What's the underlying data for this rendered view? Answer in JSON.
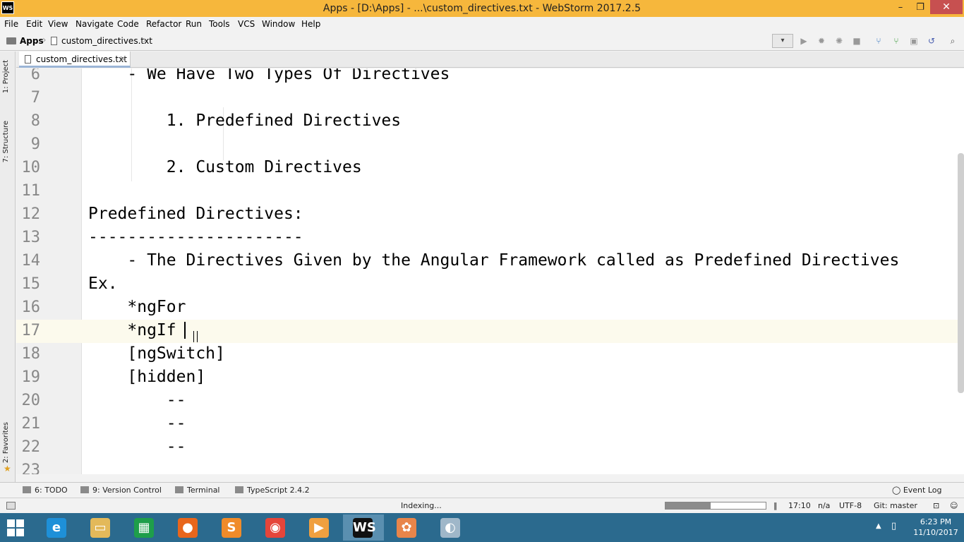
{
  "window": {
    "title": "Apps - [D:\\Apps] - ...\\custom_directives.txt - WebStorm 2017.2.5",
    "app_icon": "WS",
    "minimize": "–",
    "maximize": "❐",
    "close": "✕"
  },
  "menu": [
    "File",
    "Edit",
    "View",
    "Navigate",
    "Code",
    "Refactor",
    "Run",
    "Tools",
    "VCS",
    "Window",
    "Help"
  ],
  "breadcrumb": {
    "project": "Apps",
    "file": "custom_directives.txt"
  },
  "editor_tab": {
    "label": "custom_directives.txt",
    "close": "×"
  },
  "left_tools": {
    "project": "1: Project",
    "structure": "7: Structure",
    "favorites": "2: Favorites"
  },
  "code_lines": [
    {
      "n": "6",
      "text": "    - We Have Two Types Of Directives"
    },
    {
      "n": "7",
      "text": ""
    },
    {
      "n": "8",
      "text": "        1. Predefined Directives"
    },
    {
      "n": "9",
      "text": ""
    },
    {
      "n": "10",
      "text": "        2. Custom Directives"
    },
    {
      "n": "11",
      "text": ""
    },
    {
      "n": "12",
      "text": "Predefined Directives:"
    },
    {
      "n": "13",
      "text": "----------------------"
    },
    {
      "n": "14",
      "text": "    - The Directives Given by the Angular Framework called as Predefined Directives"
    },
    {
      "n": "15",
      "text": "Ex."
    },
    {
      "n": "16",
      "text": "    *ngFor"
    },
    {
      "n": "17",
      "text": "    *ngIf"
    },
    {
      "n": "18",
      "text": "    [ngSwitch]"
    },
    {
      "n": "19",
      "text": "    [hidden]"
    },
    {
      "n": "20",
      "text": "        --"
    },
    {
      "n": "21",
      "text": "        --"
    },
    {
      "n": "22",
      "text": "        --"
    },
    {
      "n": "23",
      "text": ""
    }
  ],
  "tool_windows": {
    "todo": "6: TODO",
    "vcs": "9: Version Control",
    "terminal": "Terminal",
    "typescript": "TypeScript 2.4.2",
    "event_log": "Event Log"
  },
  "status": {
    "indexing": "Indexing...",
    "progress": 0.45,
    "position": "17:10",
    "separator": "n/a",
    "encoding": "UTF-8",
    "vcs_branch": "Git: master"
  },
  "clock": {
    "time": "6:23 PM",
    "date": "11/10/2017"
  },
  "taskbar_apps": [
    {
      "name": "internet-explorer",
      "glyph": "e",
      "color": "#1e90d8"
    },
    {
      "name": "file-explorer",
      "glyph": "▭",
      "color": "#e3b95a"
    },
    {
      "name": "store",
      "glyph": "▦",
      "color": "#1e9e4a"
    },
    {
      "name": "firefox",
      "glyph": "●",
      "color": "#e8661c"
    },
    {
      "name": "sublime",
      "glyph": "S",
      "color": "#f08b2a"
    },
    {
      "name": "chrome",
      "glyph": "◉",
      "color": "#e5453a"
    },
    {
      "name": "media-player",
      "glyph": "▶",
      "color": "#f0a040"
    },
    {
      "name": "webstorm",
      "glyph": "WS",
      "color": "#111111"
    },
    {
      "name": "settings-app",
      "glyph": "✿",
      "color": "#e8854a"
    },
    {
      "name": "paint",
      "glyph": "◐",
      "color": "#9fb7c9"
    }
  ]
}
